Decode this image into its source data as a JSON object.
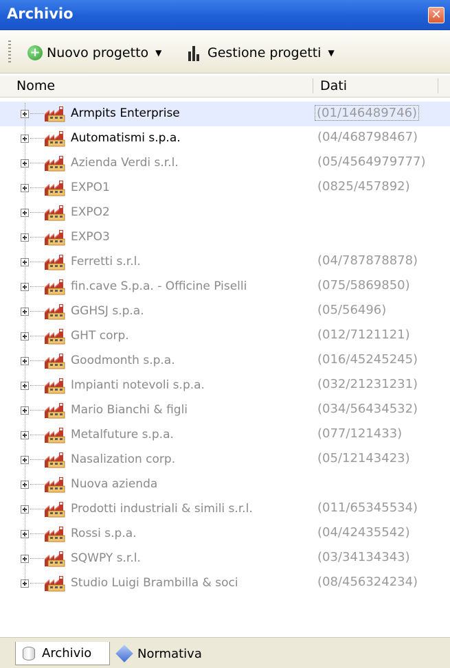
{
  "window": {
    "title": "Archivio",
    "close_glyph": "✕"
  },
  "toolbar": {
    "new_project_label": "Nuovo progetto",
    "manage_projects_label": "Gestione progetti",
    "caret_glyph": "▼"
  },
  "columns": {
    "name": "Nome",
    "data": "Dati"
  },
  "items": [
    {
      "name": "Armpits Enterprise",
      "data": "(01/146489746)"
    },
    {
      "name": "Automatismi s.p.a.",
      "data": "(04/468798467)"
    },
    {
      "name": "Azienda Verdi s.r.l.",
      "data": "(05/4564979777)"
    },
    {
      "name": "EXPO1",
      "data": "(0825/457892)"
    },
    {
      "name": "EXPO2",
      "data": ""
    },
    {
      "name": "EXPO3",
      "data": ""
    },
    {
      "name": "Ferretti s.r.l.",
      "data": "(04/787878878)"
    },
    {
      "name": "fin.cave S.p.a. - Officine Piselli",
      "data": "(075/5869850)"
    },
    {
      "name": "GGHSJ s.p.a.",
      "data": "(05/56496)"
    },
    {
      "name": "GHT corp.",
      "data": "(012/7121121)"
    },
    {
      "name": "Goodmonth s.p.a.",
      "data": "(016/45245245)"
    },
    {
      "name": "Impianti notevoli s.p.a.",
      "data": "(032/21231231)"
    },
    {
      "name": "Mario Bianchi & figli",
      "data": "(034/56434532)"
    },
    {
      "name": "Metalfuture s.p.a.",
      "data": "(077/121433)"
    },
    {
      "name": "Nasalization corp.",
      "data": "(05/12143423)"
    },
    {
      "name": "Nuova azienda",
      "data": ""
    },
    {
      "name": "Prodotti industriali & simili s.r.l.",
      "data": "(011/65345534)"
    },
    {
      "name": "Rossi s.p.a.",
      "data": "(04/42435542)"
    },
    {
      "name": "SQWPY s.r.l.",
      "data": "(03/34134343)"
    },
    {
      "name": "Studio Luigi Brambilla & soci",
      "data": "(08/456324234)"
    }
  ],
  "tabs": {
    "archive": "Archivio",
    "regulations": "Normativa"
  },
  "colors": {
    "title_bar": "#1f5fd6",
    "selection": "#e6ecff",
    "muted_text": "#8a8a8a"
  }
}
